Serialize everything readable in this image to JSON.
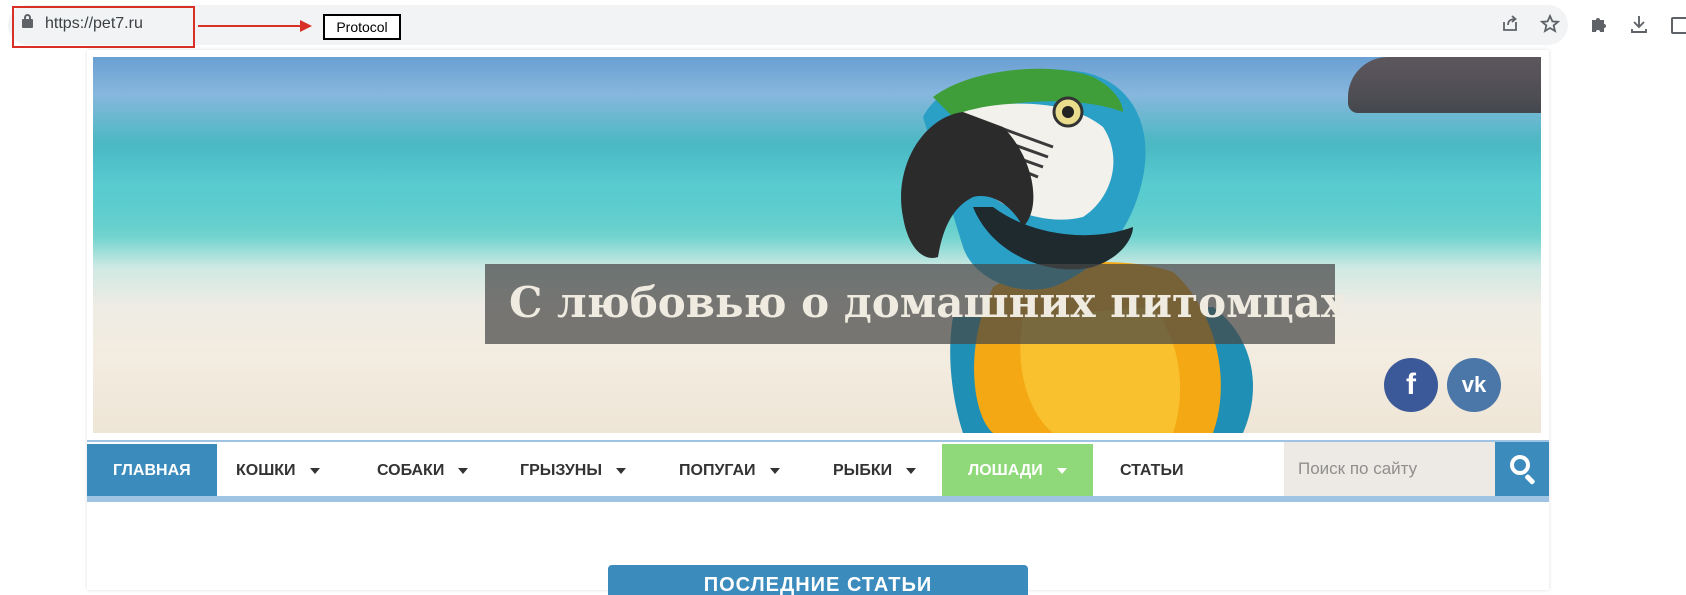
{
  "browser": {
    "url": "https://pet7.ru",
    "annotation_label": "Protocol",
    "icons": [
      "lock-icon",
      "share-icon",
      "star-icon",
      "extensions-icon",
      "download-icon",
      "side-panel-icon"
    ]
  },
  "header": {
    "title": "С любовью о домашних питомцах",
    "social": {
      "facebook": "f",
      "vk": "vk"
    }
  },
  "nav": {
    "items": [
      {
        "label": "ГЛАВНАЯ",
        "dropdown": false
      },
      {
        "label": "КОШКИ",
        "dropdown": true
      },
      {
        "label": "СОБАКИ",
        "dropdown": true
      },
      {
        "label": "ГРЫЗУНЫ",
        "dropdown": true
      },
      {
        "label": "ПОПУГАИ",
        "dropdown": true
      },
      {
        "label": "РЫБКИ",
        "dropdown": true
      },
      {
        "label": "ЛОШАДИ",
        "dropdown": true
      },
      {
        "label": "СТАТЬИ",
        "dropdown": false
      }
    ],
    "search_placeholder": "Поиск по сайту"
  },
  "main": {
    "latest_label": "ПОСЛЕДНИЕ СТАТЬИ"
  },
  "colors": {
    "accent": "#3b8bbd",
    "green": "#8fd97a",
    "annotation": "#d93025"
  }
}
